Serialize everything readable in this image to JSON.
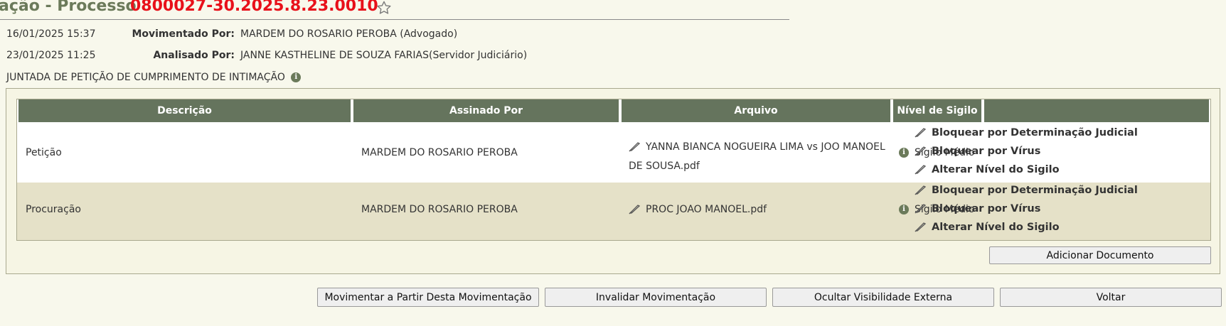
{
  "header": {
    "title_prefix": "ação - Processo",
    "process_number": "0800027-30.2025.8.23.0010",
    "favorite_icon": "star-outline-icon"
  },
  "movement": {
    "date_moved": "16/01/2025 15:37",
    "moved_by_label": "Movimentado Por:",
    "moved_by_value": "MARDEM DO ROSARIO PEROBA (Advogado)",
    "date_analyzed": "23/01/2025 11:25",
    "analyzed_by_label": "Analisado Por:",
    "analyzed_by_value": "JANNE KASTHELINE DE SOUZA FARIAS(Servidor Judiciário)",
    "title": "JUNTADA DE PETIÇÃO DE CUMPRIMENTO DE INTIMAÇÃO",
    "info_icon": "i"
  },
  "table": {
    "headers": [
      "Descrição",
      "Assinado Por",
      "Arquivo",
      "Nível de Sigilo",
      ""
    ],
    "rows": [
      {
        "descricao": "Petição",
        "assinado_por": "MARDEM DO ROSARIO PEROBA",
        "arquivo_line1": "YANNA BIANCA NOGUEIRA LIMA vs JOO MANOEL",
        "arquivo_line2": "DE SOUSA.pdf",
        "sigilo": "Sigilo Médio",
        "actions": [
          "Bloquear por Determinação Judicial",
          "Bloquear por Vírus",
          "Alterar Nível do Sigilo"
        ]
      },
      {
        "descricao": "Procuração",
        "assinado_por": "MARDEM DO ROSARIO PEROBA",
        "arquivo_line1": "PROC JOAO MANOEL.pdf",
        "arquivo_line2": "",
        "sigilo": "Sigilo Médio",
        "actions": [
          "Bloquear por Determinação Judicial",
          "Bloquear por Vírus",
          "Alterar Nível do Sigilo"
        ]
      }
    ],
    "add_document_label": "Adicionar Documento"
  },
  "footer_buttons": {
    "move_from": "Movimentar a Partir Desta Movimentação",
    "invalidate": "Invalidar Movimentação",
    "hide_external": "Ocultar Visibilidade Externa",
    "back": "Voltar"
  },
  "colors": {
    "header_green": "#65745d",
    "process_red": "#e8101a",
    "row_beige": "#e5e1c8"
  }
}
